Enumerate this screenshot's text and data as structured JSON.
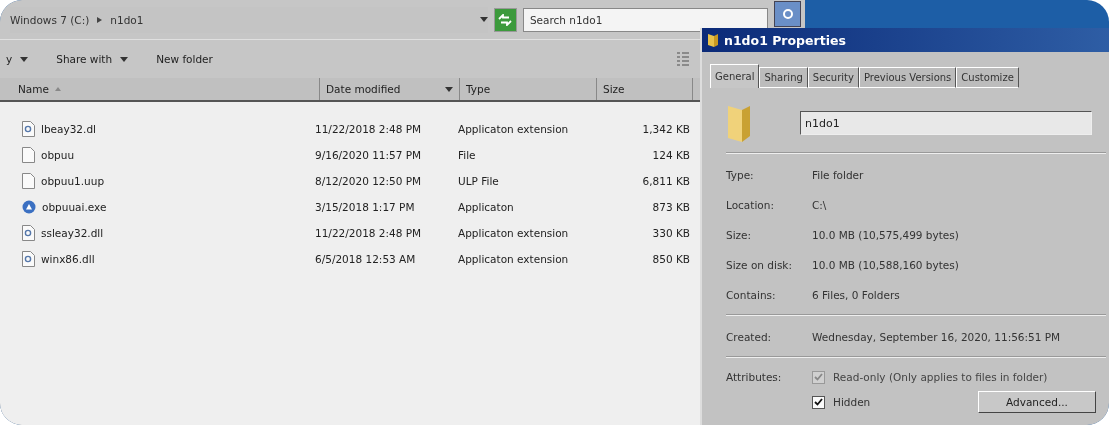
{
  "address_bar": {
    "crumbs": [
      "Windows 7 (C:)",
      "n1do1"
    ]
  },
  "search": {
    "placeholder": "Search n1do1"
  },
  "toolbar": {
    "items": [
      {
        "label": "y",
        "dropdown": true
      },
      {
        "label": "Share with",
        "dropdown": true
      },
      {
        "label": "New folder",
        "dropdown": false
      }
    ]
  },
  "table": {
    "columns": [
      {
        "label": "Name",
        "sorted": true,
        "filter": false
      },
      {
        "label": "Date modified",
        "sorted": false,
        "filter": true
      },
      {
        "label": "Type",
        "sorted": false,
        "filter": false
      },
      {
        "label": "Size",
        "sorted": false,
        "filter": false
      }
    ],
    "rows": [
      {
        "kind": "dll",
        "name": "lbeay32.dl",
        "date": "11/22/2018 2:48 PM",
        "type": "Applicaton extension",
        "size": "1,342 KB"
      },
      {
        "kind": "file",
        "name": "obpuu",
        "date": "9/16/2020 11:57 PM",
        "type": "File",
        "size": "124 KB"
      },
      {
        "kind": "file",
        "name": "obpuu1.uup",
        "date": "8/12/2020 12:50 PM",
        "type": "ULP File",
        "size": "6,811 KB"
      },
      {
        "kind": "exe",
        "name": "obpuuai.exe",
        "date": "3/15/2018 1:17 PM",
        "type": "Applicaton",
        "size": "873 KB"
      },
      {
        "kind": "dll",
        "name": "ssleay32.dll",
        "date": "11/22/2018 2:48 PM",
        "type": "Applicaton extension",
        "size": "330 KB"
      },
      {
        "kind": "dll",
        "name": "winx86.dll",
        "date": "6/5/2018 12:53 AM",
        "type": "Applicaton extension",
        "size": "850 KB"
      }
    ]
  },
  "dialog": {
    "title": "n1do1 Properties",
    "tabs": [
      {
        "label": "General",
        "selected": true
      },
      {
        "label": "Sharing",
        "selected": false
      },
      {
        "label": "Security",
        "selected": false
      },
      {
        "label": "Previous Versions",
        "selected": false
      },
      {
        "label": "Customize",
        "selected": false
      }
    ],
    "name_value": "n1do1",
    "sections": [
      [
        {
          "label": "Type:",
          "value": "File folder"
        },
        {
          "label": "Location:",
          "value": "C:\\"
        },
        {
          "label": "Size:",
          "value": "10.0 MB (10,575,499 bytes)"
        },
        {
          "label": "Size on disk:",
          "value": "10.0 MB (10,588,160 bytes)"
        },
        {
          "label": "Contains:",
          "value": "6 Files, 0 Folders"
        }
      ],
      [
        {
          "label": "Created:",
          "value": "Wednesday, September 16, 2020, 11:56:51 PM"
        }
      ]
    ],
    "attributes_label": "Attributes:",
    "checkboxes": [
      {
        "label": "Read-only (Only applies to files in folder)",
        "checked": true,
        "disabled": true
      },
      {
        "label": "Hidden",
        "checked": true,
        "disabled": false
      }
    ],
    "advanced_button": "Advanced..."
  }
}
